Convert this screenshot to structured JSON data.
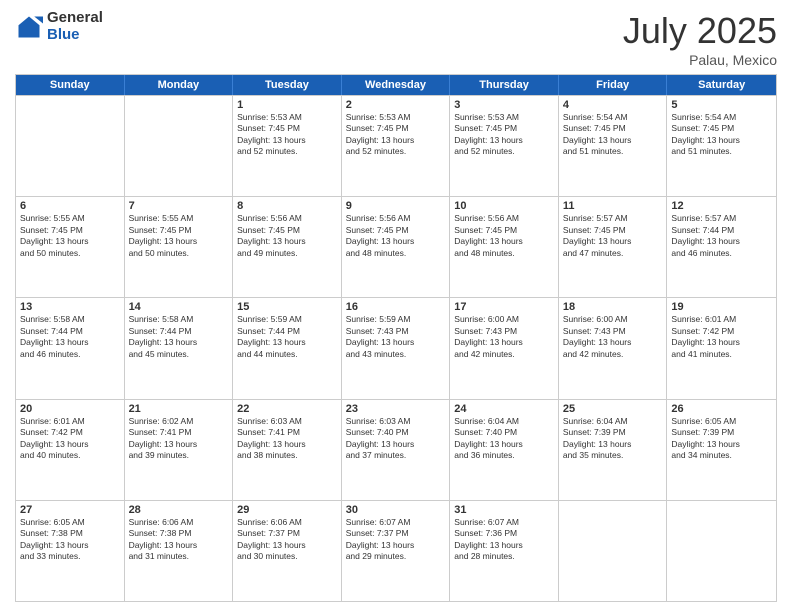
{
  "logo": {
    "general": "General",
    "blue": "Blue"
  },
  "header": {
    "month": "July 2025",
    "location": "Palau, Mexico"
  },
  "days": [
    "Sunday",
    "Monday",
    "Tuesday",
    "Wednesday",
    "Thursday",
    "Friday",
    "Saturday"
  ],
  "weeks": [
    [
      {
        "day": "",
        "lines": []
      },
      {
        "day": "",
        "lines": []
      },
      {
        "day": "1",
        "lines": [
          "Sunrise: 5:53 AM",
          "Sunset: 7:45 PM",
          "Daylight: 13 hours",
          "and 52 minutes."
        ]
      },
      {
        "day": "2",
        "lines": [
          "Sunrise: 5:53 AM",
          "Sunset: 7:45 PM",
          "Daylight: 13 hours",
          "and 52 minutes."
        ]
      },
      {
        "day": "3",
        "lines": [
          "Sunrise: 5:53 AM",
          "Sunset: 7:45 PM",
          "Daylight: 13 hours",
          "and 52 minutes."
        ]
      },
      {
        "day": "4",
        "lines": [
          "Sunrise: 5:54 AM",
          "Sunset: 7:45 PM",
          "Daylight: 13 hours",
          "and 51 minutes."
        ]
      },
      {
        "day": "5",
        "lines": [
          "Sunrise: 5:54 AM",
          "Sunset: 7:45 PM",
          "Daylight: 13 hours",
          "and 51 minutes."
        ]
      }
    ],
    [
      {
        "day": "6",
        "lines": [
          "Sunrise: 5:55 AM",
          "Sunset: 7:45 PM",
          "Daylight: 13 hours",
          "and 50 minutes."
        ]
      },
      {
        "day": "7",
        "lines": [
          "Sunrise: 5:55 AM",
          "Sunset: 7:45 PM",
          "Daylight: 13 hours",
          "and 50 minutes."
        ]
      },
      {
        "day": "8",
        "lines": [
          "Sunrise: 5:56 AM",
          "Sunset: 7:45 PM",
          "Daylight: 13 hours",
          "and 49 minutes."
        ]
      },
      {
        "day": "9",
        "lines": [
          "Sunrise: 5:56 AM",
          "Sunset: 7:45 PM",
          "Daylight: 13 hours",
          "and 48 minutes."
        ]
      },
      {
        "day": "10",
        "lines": [
          "Sunrise: 5:56 AM",
          "Sunset: 7:45 PM",
          "Daylight: 13 hours",
          "and 48 minutes."
        ]
      },
      {
        "day": "11",
        "lines": [
          "Sunrise: 5:57 AM",
          "Sunset: 7:45 PM",
          "Daylight: 13 hours",
          "and 47 minutes."
        ]
      },
      {
        "day": "12",
        "lines": [
          "Sunrise: 5:57 AM",
          "Sunset: 7:44 PM",
          "Daylight: 13 hours",
          "and 46 minutes."
        ]
      }
    ],
    [
      {
        "day": "13",
        "lines": [
          "Sunrise: 5:58 AM",
          "Sunset: 7:44 PM",
          "Daylight: 13 hours",
          "and 46 minutes."
        ]
      },
      {
        "day": "14",
        "lines": [
          "Sunrise: 5:58 AM",
          "Sunset: 7:44 PM",
          "Daylight: 13 hours",
          "and 45 minutes."
        ]
      },
      {
        "day": "15",
        "lines": [
          "Sunrise: 5:59 AM",
          "Sunset: 7:44 PM",
          "Daylight: 13 hours",
          "and 44 minutes."
        ]
      },
      {
        "day": "16",
        "lines": [
          "Sunrise: 5:59 AM",
          "Sunset: 7:43 PM",
          "Daylight: 13 hours",
          "and 43 minutes."
        ]
      },
      {
        "day": "17",
        "lines": [
          "Sunrise: 6:00 AM",
          "Sunset: 7:43 PM",
          "Daylight: 13 hours",
          "and 42 minutes."
        ]
      },
      {
        "day": "18",
        "lines": [
          "Sunrise: 6:00 AM",
          "Sunset: 7:43 PM",
          "Daylight: 13 hours",
          "and 42 minutes."
        ]
      },
      {
        "day": "19",
        "lines": [
          "Sunrise: 6:01 AM",
          "Sunset: 7:42 PM",
          "Daylight: 13 hours",
          "and 41 minutes."
        ]
      }
    ],
    [
      {
        "day": "20",
        "lines": [
          "Sunrise: 6:01 AM",
          "Sunset: 7:42 PM",
          "Daylight: 13 hours",
          "and 40 minutes."
        ]
      },
      {
        "day": "21",
        "lines": [
          "Sunrise: 6:02 AM",
          "Sunset: 7:41 PM",
          "Daylight: 13 hours",
          "and 39 minutes."
        ]
      },
      {
        "day": "22",
        "lines": [
          "Sunrise: 6:03 AM",
          "Sunset: 7:41 PM",
          "Daylight: 13 hours",
          "and 38 minutes."
        ]
      },
      {
        "day": "23",
        "lines": [
          "Sunrise: 6:03 AM",
          "Sunset: 7:40 PM",
          "Daylight: 13 hours",
          "and 37 minutes."
        ]
      },
      {
        "day": "24",
        "lines": [
          "Sunrise: 6:04 AM",
          "Sunset: 7:40 PM",
          "Daylight: 13 hours",
          "and 36 minutes."
        ]
      },
      {
        "day": "25",
        "lines": [
          "Sunrise: 6:04 AM",
          "Sunset: 7:39 PM",
          "Daylight: 13 hours",
          "and 35 minutes."
        ]
      },
      {
        "day": "26",
        "lines": [
          "Sunrise: 6:05 AM",
          "Sunset: 7:39 PM",
          "Daylight: 13 hours",
          "and 34 minutes."
        ]
      }
    ],
    [
      {
        "day": "27",
        "lines": [
          "Sunrise: 6:05 AM",
          "Sunset: 7:38 PM",
          "Daylight: 13 hours",
          "and 33 minutes."
        ]
      },
      {
        "day": "28",
        "lines": [
          "Sunrise: 6:06 AM",
          "Sunset: 7:38 PM",
          "Daylight: 13 hours",
          "and 31 minutes."
        ]
      },
      {
        "day": "29",
        "lines": [
          "Sunrise: 6:06 AM",
          "Sunset: 7:37 PM",
          "Daylight: 13 hours",
          "and 30 minutes."
        ]
      },
      {
        "day": "30",
        "lines": [
          "Sunrise: 6:07 AM",
          "Sunset: 7:37 PM",
          "Daylight: 13 hours",
          "and 29 minutes."
        ]
      },
      {
        "day": "31",
        "lines": [
          "Sunrise: 6:07 AM",
          "Sunset: 7:36 PM",
          "Daylight: 13 hours",
          "and 28 minutes."
        ]
      },
      {
        "day": "",
        "lines": []
      },
      {
        "day": "",
        "lines": []
      }
    ]
  ]
}
